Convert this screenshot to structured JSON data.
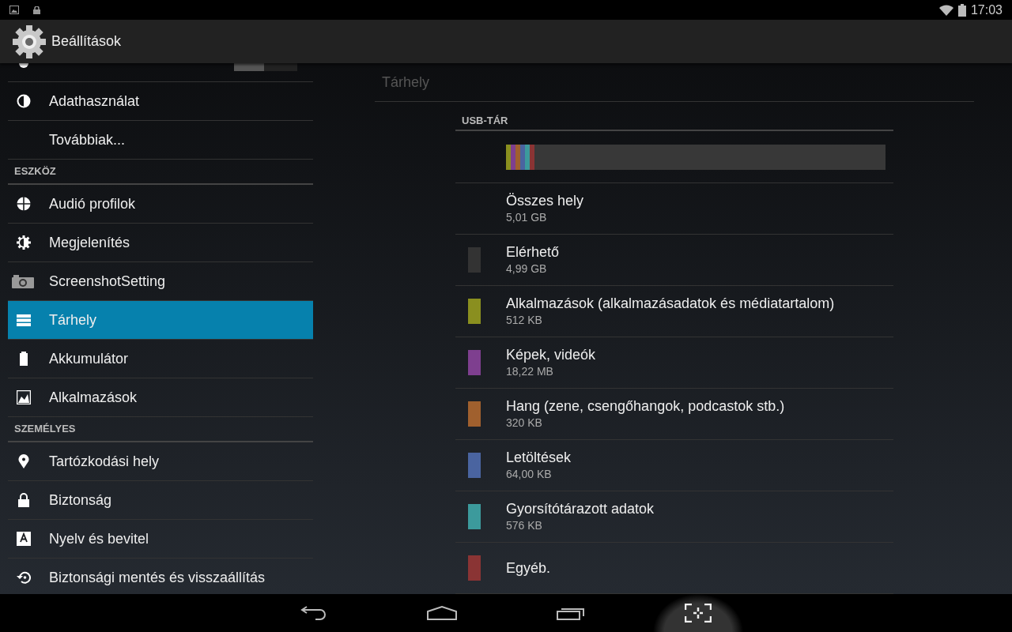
{
  "status_bar": {
    "time": "17:03"
  },
  "action_bar": {
    "title": "Beállítások"
  },
  "sidebar": {
    "items": [
      {
        "kind": "cut_off",
        "toggle": {
          "on": false
        }
      },
      {
        "kind": "item",
        "label": "Adathasználat",
        "selected": false
      },
      {
        "kind": "item",
        "label": "Továbbiak...",
        "selected": false
      },
      {
        "kind": "header",
        "label": "ESZKÖZ"
      },
      {
        "kind": "item",
        "label": "Audió profilok",
        "selected": false
      },
      {
        "kind": "item",
        "label": "Megjelenítés",
        "selected": false
      },
      {
        "kind": "item",
        "label": "ScreenshotSetting",
        "selected": false
      },
      {
        "kind": "item",
        "label": "Tárhely",
        "selected": true
      },
      {
        "kind": "item",
        "label": "Akkumulátor",
        "selected": false
      },
      {
        "kind": "item",
        "label": "Alkalmazások",
        "selected": false
      },
      {
        "kind": "header",
        "label": "SZEMÉLYES"
      },
      {
        "kind": "item",
        "label": "Tartózkodási hely",
        "selected": false
      },
      {
        "kind": "item",
        "label": "Biztonság",
        "selected": false
      },
      {
        "kind": "item",
        "label": "Nyelv és bevitel",
        "selected": false
      },
      {
        "kind": "item",
        "label": "Biztonsági mentés és visszaállítás",
        "selected": false
      }
    ]
  },
  "content": {
    "title": "Tárhely",
    "section": "USB-TÁR",
    "usage_bar": {
      "segments": [
        {
          "color": "#8a8f1f",
          "level": 0.0125
        },
        {
          "color": "#7e3f8f",
          "level": 0.0125
        },
        {
          "color": "#a0602e",
          "level": 0.0125
        },
        {
          "color": "#4a64a0",
          "level": 0.0125
        },
        {
          "color": "#3c9a9c",
          "level": 0.0125
        },
        {
          "color": "#8a3434",
          "level": 0.0125
        }
      ]
    },
    "rows": [
      {
        "label": "Összes hely",
        "size": "5,01 GB"
      },
      {
        "label": "Elérhető",
        "size": "4,99 GB",
        "color": "#333333"
      },
      {
        "label": "Alkalmazások (alkalmazásadatok és médiatartalom)",
        "size": "512 KB",
        "color": "#8a8f1f"
      },
      {
        "label": "Képek, videók",
        "size": "18,22 MB",
        "color": "#7e3f8f"
      },
      {
        "label": "Hang (zene, csengőhangok, podcastok stb.)",
        "size": "320 KB",
        "color": "#a0602e"
      },
      {
        "label": "Letöltések",
        "size": "64,00 KB",
        "color": "#4a64a0"
      },
      {
        "label": "Gyorsítótárazott adatok",
        "size": "576 KB",
        "color": "#3c9a9c"
      },
      {
        "label": "Egyéb.",
        "color": "#8a3434"
      }
    ]
  }
}
